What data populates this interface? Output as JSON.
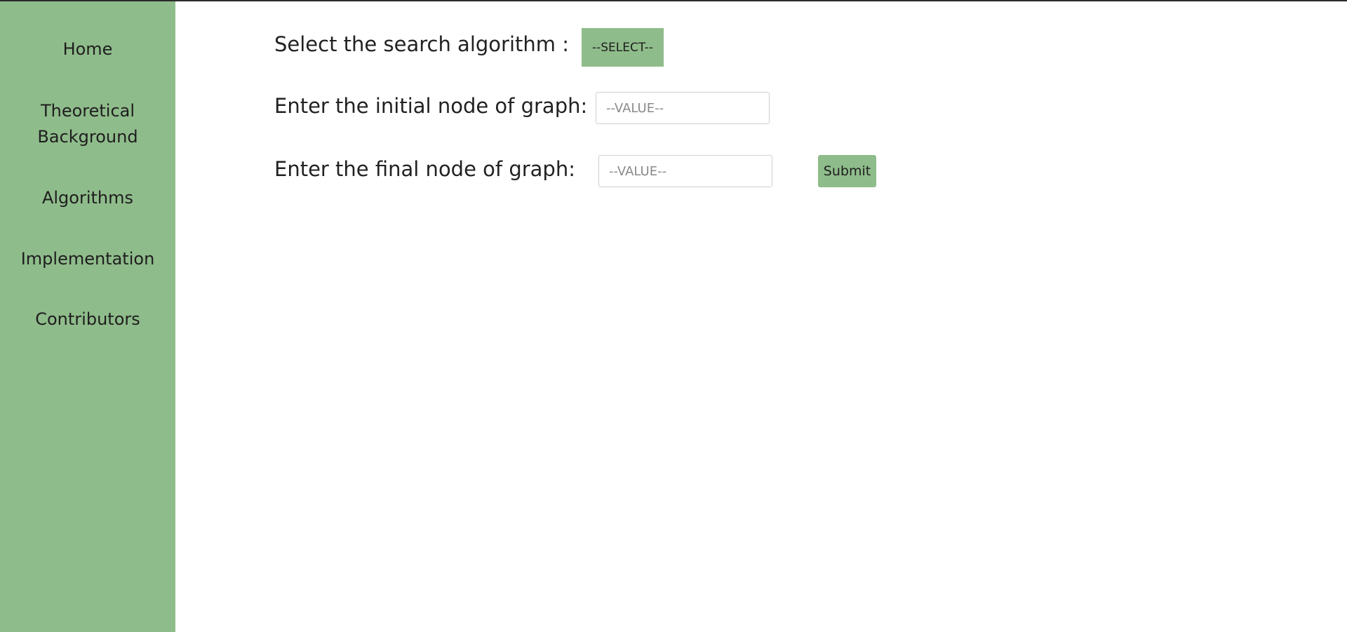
{
  "colors": {
    "accent": "#8fbc8b",
    "top_border": "#2b2b2b",
    "input_border": "#cfcfcf",
    "placeholder": "#8a8a8a"
  },
  "sidebar": {
    "items": [
      {
        "label": "Home"
      },
      {
        "label": "Theoretical"
      },
      {
        "label": "Background"
      },
      {
        "label": "Algorithms"
      },
      {
        "label": "Implementation"
      },
      {
        "label": "Contributors"
      }
    ]
  },
  "form": {
    "algorithm_label": "Select the search algorithm :",
    "algorithm_select": "--SELECT--",
    "initial_label": "Enter the initial node of graph:",
    "initial_placeholder": "--VALUE--",
    "initial_value": "",
    "final_label": "Enter the final node of graph:",
    "final_placeholder": "--VALUE--",
    "final_value": "",
    "submit_label": "Submit"
  }
}
